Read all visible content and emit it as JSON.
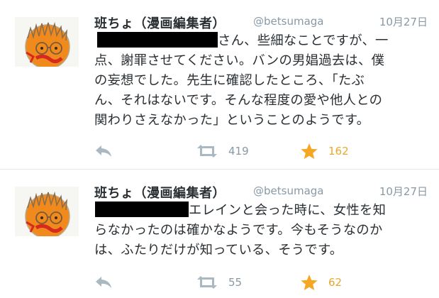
{
  "tweets": [
    {
      "display_name": "班ちょ（漫画編集者）",
      "screen_name": "@betsumaga",
      "timestamp": "10月27日",
      "lines": [
        "さん、些細なことですが、一",
        "点、謝罪させてください。バンの男娼過去は、僕",
        "の妄想でした。先生に確認したところ、「たぶ",
        "ん、それはないです。そんな程度の愛や他人との",
        "関わりさえなかった」ということのようです。"
      ],
      "retweet_count": "419",
      "favorite_count": "162"
    },
    {
      "display_name": "班ちょ（漫画編集者）",
      "screen_name": "@betsumaga",
      "timestamp": "10月27日",
      "lines": [
        "エレインと会った時に、女性を知",
        "らなかったのは確かなようです。今もそうなのか",
        "は、ふたりだけが知っている、そうです。"
      ],
      "retweet_count": "55",
      "favorite_count": "62"
    }
  ],
  "icons": {
    "reply": "reply-icon",
    "retweet": "retweet-icon",
    "favorite": "star-icon"
  },
  "colors": {
    "text": "#292f33",
    "muted": "#8899a6",
    "action_icon": "#aab8c2",
    "favorite": "#f5a623",
    "favorite_count": "#e9a82d",
    "divider": "#e1e8ed",
    "avatar_face": "#f08a1c",
    "avatar_mouth": "#d62a1e"
  }
}
